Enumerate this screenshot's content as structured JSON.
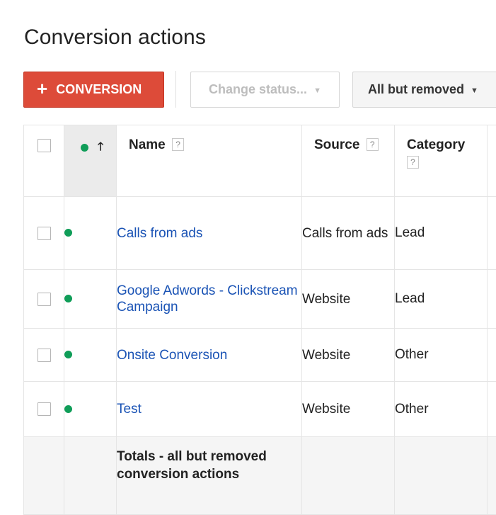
{
  "page": {
    "title": "Conversion actions"
  },
  "toolbar": {
    "add_button_label": "CONVERSION",
    "change_status_label": "Change status...",
    "filter_label": "All but removed"
  },
  "table": {
    "columns": {
      "name": "Name",
      "source": "Source",
      "category": "Category"
    },
    "help_glyph": "?",
    "rows": [
      {
        "name": "Calls from ads",
        "source": "Calls from ads",
        "category": "Lead",
        "status": "enabled"
      },
      {
        "name": "Google Adwords - Clickstream Campaign",
        "source": "Website",
        "category": "Lead",
        "status": "enabled"
      },
      {
        "name": "Onsite Conversion",
        "source": "Website",
        "category": "Other",
        "status": "enabled"
      },
      {
        "name": "Test",
        "source": "Website",
        "category": "Other",
        "status": "enabled"
      }
    ],
    "totals_label": "Totals - all but removed conversion actions"
  },
  "icons": {
    "add": "plus-icon",
    "dropdown": "caret-down-icon",
    "sort": "arrow-up-icon",
    "status": "green-dot-icon",
    "help": "help-icon"
  },
  "colors": {
    "primary_button": "#dd4b39",
    "link": "#1a53b5",
    "status_enabled": "#0f9d58"
  }
}
